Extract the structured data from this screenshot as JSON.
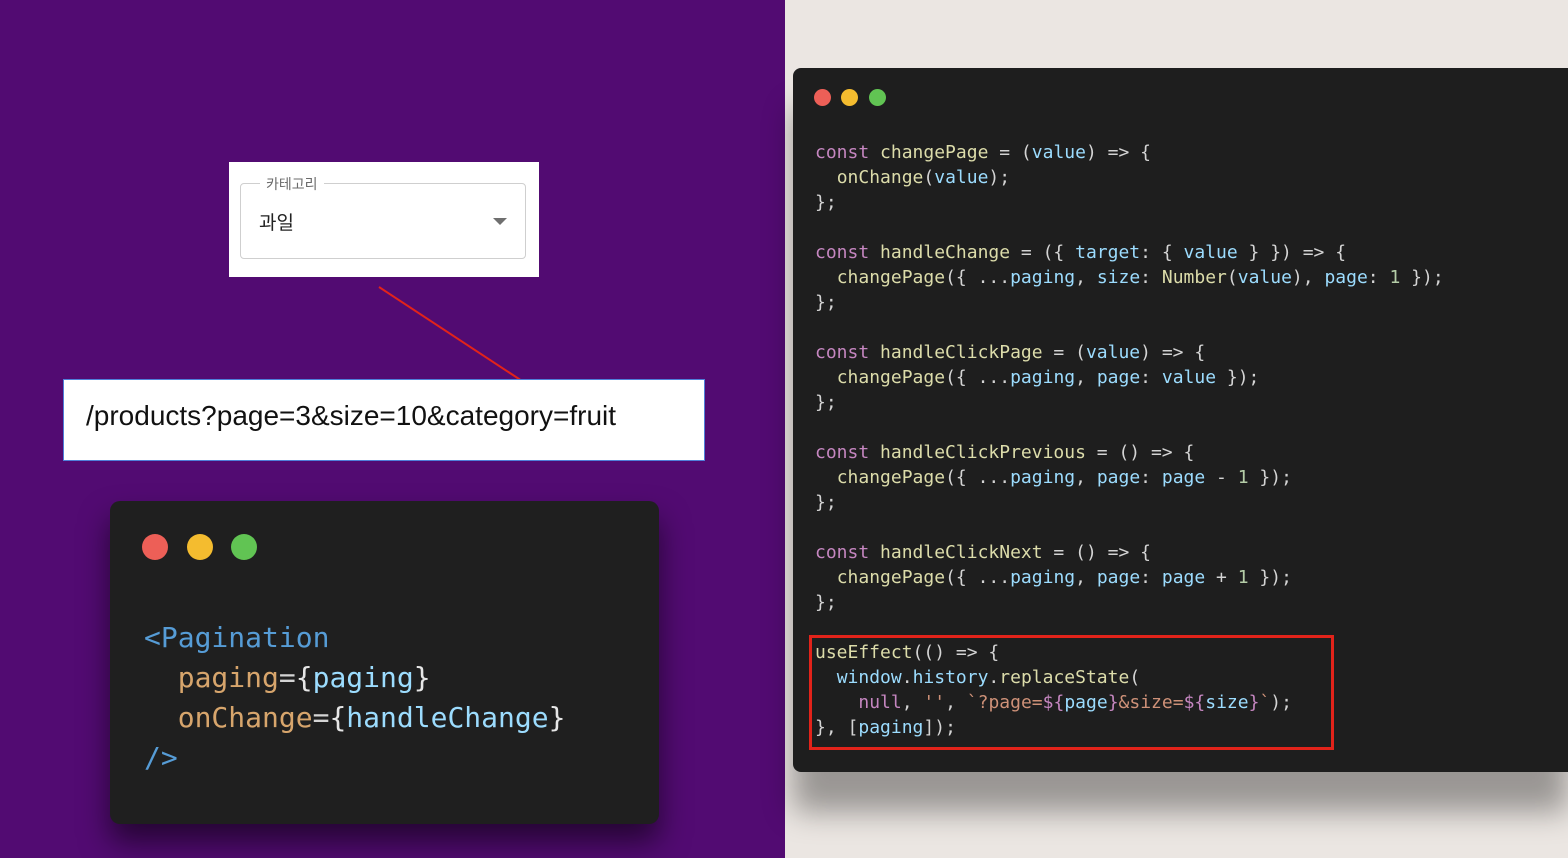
{
  "category_select": {
    "label": "카테고리",
    "value": "과일",
    "icon": "chevron-down-icon"
  },
  "url": {
    "text": "/products?page=3&size=10&category=fruit"
  },
  "mini_editor": {
    "window_dots": [
      "#ed5f57",
      "#f4bc2f",
      "#61c453"
    ],
    "lines": [
      "<Pagination",
      "  paging={paging}",
      "  onChange={handleChange}",
      "/>"
    ]
  },
  "main_editor": {
    "window_dots": [
      "#ed5f57",
      "#f4bc2f",
      "#61c453"
    ],
    "lines": [
      "const changePage = (value) => {",
      "  onChange(value);",
      "};",
      "",
      "const handleChange = ({ target: { value } }) => {",
      "  changePage({ ...paging, size: Number(value), page: 1 });",
      "};",
      "",
      "const handleClickPage = (value) => {",
      "  changePage({ ...paging, page: value });",
      "};",
      "",
      "const handleClickPrevious = () => {",
      "  changePage({ ...paging, page: page - 1 });",
      "};",
      "",
      "const handleClickNext = () => {",
      "  changePage({ ...paging, page: page + 1 });",
      "};",
      "",
      "useEffect(() => {",
      "  window.history.replaceState(",
      "    null, '', `?page=${page}&size=${size}`);",
      "}, [paging]);"
    ],
    "highlight_color": "#e2231a"
  },
  "colors": {
    "left_background": "#520b72",
    "right_background": "#ebe6e2",
    "editor_background": "#1e1e1e",
    "arrow": "#e2231a"
  }
}
